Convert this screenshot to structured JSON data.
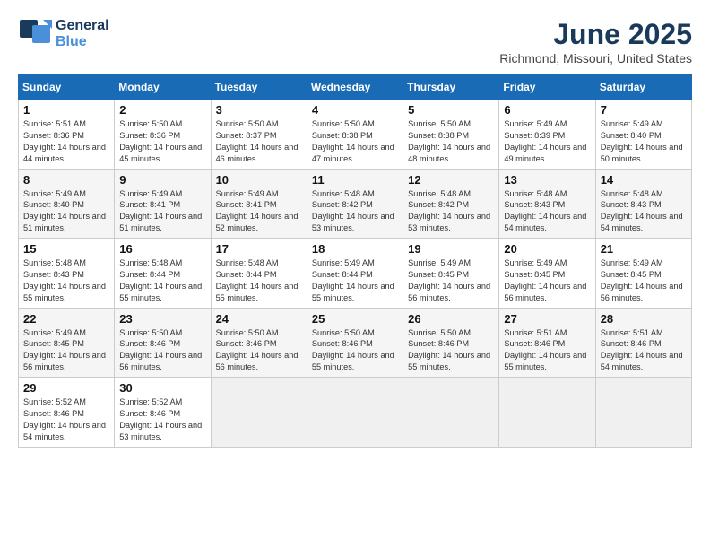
{
  "header": {
    "logo_line1": "General",
    "logo_line2": "Blue",
    "month": "June 2025",
    "location": "Richmond, Missouri, United States"
  },
  "weekdays": [
    "Sunday",
    "Monday",
    "Tuesday",
    "Wednesday",
    "Thursday",
    "Friday",
    "Saturday"
  ],
  "weeks": [
    [
      {
        "day": "1",
        "sunrise": "5:51 AM",
        "sunset": "8:36 PM",
        "daylight": "14 hours and 44 minutes."
      },
      {
        "day": "2",
        "sunrise": "5:50 AM",
        "sunset": "8:36 PM",
        "daylight": "14 hours and 45 minutes."
      },
      {
        "day": "3",
        "sunrise": "5:50 AM",
        "sunset": "8:37 PM",
        "daylight": "14 hours and 46 minutes."
      },
      {
        "day": "4",
        "sunrise": "5:50 AM",
        "sunset": "8:38 PM",
        "daylight": "14 hours and 47 minutes."
      },
      {
        "day": "5",
        "sunrise": "5:50 AM",
        "sunset": "8:38 PM",
        "daylight": "14 hours and 48 minutes."
      },
      {
        "day": "6",
        "sunrise": "5:49 AM",
        "sunset": "8:39 PM",
        "daylight": "14 hours and 49 minutes."
      },
      {
        "day": "7",
        "sunrise": "5:49 AM",
        "sunset": "8:40 PM",
        "daylight": "14 hours and 50 minutes."
      }
    ],
    [
      {
        "day": "8",
        "sunrise": "5:49 AM",
        "sunset": "8:40 PM",
        "daylight": "14 hours and 51 minutes."
      },
      {
        "day": "9",
        "sunrise": "5:49 AM",
        "sunset": "8:41 PM",
        "daylight": "14 hours and 51 minutes."
      },
      {
        "day": "10",
        "sunrise": "5:49 AM",
        "sunset": "8:41 PM",
        "daylight": "14 hours and 52 minutes."
      },
      {
        "day": "11",
        "sunrise": "5:48 AM",
        "sunset": "8:42 PM",
        "daylight": "14 hours and 53 minutes."
      },
      {
        "day": "12",
        "sunrise": "5:48 AM",
        "sunset": "8:42 PM",
        "daylight": "14 hours and 53 minutes."
      },
      {
        "day": "13",
        "sunrise": "5:48 AM",
        "sunset": "8:43 PM",
        "daylight": "14 hours and 54 minutes."
      },
      {
        "day": "14",
        "sunrise": "5:48 AM",
        "sunset": "8:43 PM",
        "daylight": "14 hours and 54 minutes."
      }
    ],
    [
      {
        "day": "15",
        "sunrise": "5:48 AM",
        "sunset": "8:43 PM",
        "daylight": "14 hours and 55 minutes."
      },
      {
        "day": "16",
        "sunrise": "5:48 AM",
        "sunset": "8:44 PM",
        "daylight": "14 hours and 55 minutes."
      },
      {
        "day": "17",
        "sunrise": "5:48 AM",
        "sunset": "8:44 PM",
        "daylight": "14 hours and 55 minutes."
      },
      {
        "day": "18",
        "sunrise": "5:49 AM",
        "sunset": "8:44 PM",
        "daylight": "14 hours and 55 minutes."
      },
      {
        "day": "19",
        "sunrise": "5:49 AM",
        "sunset": "8:45 PM",
        "daylight": "14 hours and 56 minutes."
      },
      {
        "day": "20",
        "sunrise": "5:49 AM",
        "sunset": "8:45 PM",
        "daylight": "14 hours and 56 minutes."
      },
      {
        "day": "21",
        "sunrise": "5:49 AM",
        "sunset": "8:45 PM",
        "daylight": "14 hours and 56 minutes."
      }
    ],
    [
      {
        "day": "22",
        "sunrise": "5:49 AM",
        "sunset": "8:45 PM",
        "daylight": "14 hours and 56 minutes."
      },
      {
        "day": "23",
        "sunrise": "5:50 AM",
        "sunset": "8:46 PM",
        "daylight": "14 hours and 56 minutes."
      },
      {
        "day": "24",
        "sunrise": "5:50 AM",
        "sunset": "8:46 PM",
        "daylight": "14 hours and 56 minutes."
      },
      {
        "day": "25",
        "sunrise": "5:50 AM",
        "sunset": "8:46 PM",
        "daylight": "14 hours and 55 minutes."
      },
      {
        "day": "26",
        "sunrise": "5:50 AM",
        "sunset": "8:46 PM",
        "daylight": "14 hours and 55 minutes."
      },
      {
        "day": "27",
        "sunrise": "5:51 AM",
        "sunset": "8:46 PM",
        "daylight": "14 hours and 55 minutes."
      },
      {
        "day": "28",
        "sunrise": "5:51 AM",
        "sunset": "8:46 PM",
        "daylight": "14 hours and 54 minutes."
      }
    ],
    [
      {
        "day": "29",
        "sunrise": "5:52 AM",
        "sunset": "8:46 PM",
        "daylight": "14 hours and 54 minutes."
      },
      {
        "day": "30",
        "sunrise": "5:52 AM",
        "sunset": "8:46 PM",
        "daylight": "14 hours and 53 minutes."
      },
      null,
      null,
      null,
      null,
      null
    ]
  ]
}
